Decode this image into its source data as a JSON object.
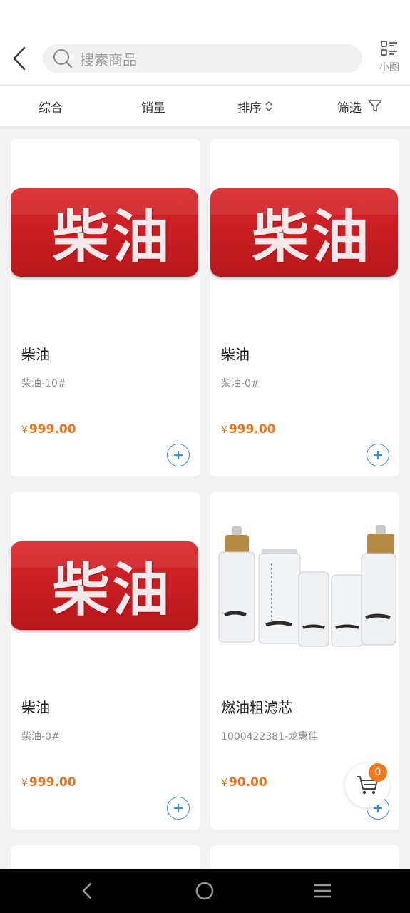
{
  "header": {
    "search_placeholder": "搜索商品",
    "view_toggle_label": "小图"
  },
  "sort_bar": {
    "items": [
      {
        "label": "综合"
      },
      {
        "label": "销量"
      },
      {
        "label": "排序"
      },
      {
        "label": "筛选"
      }
    ]
  },
  "products": [
    {
      "title": "柴油",
      "subtitle": "柴油-10#",
      "currency": "¥",
      "price": "999.00",
      "image_text": "柴油"
    },
    {
      "title": "柴油",
      "subtitle": "柴油-0#",
      "currency": "¥",
      "price": "999.00",
      "image_text": "柴油"
    },
    {
      "title": "柴油",
      "subtitle": "柴油-0#",
      "currency": "¥",
      "price": "999.00",
      "image_text": "柴油"
    },
    {
      "title": "燃油粗滤芯",
      "subtitle": "1000422381-龙惠佳",
      "currency": "¥",
      "price": "90.00"
    }
  ],
  "cart": {
    "count": "0"
  },
  "colors": {
    "price": "#e8731c",
    "accent": "#3b8fe0",
    "badge": "#f47a1d",
    "banner_red": "#d8252a"
  }
}
